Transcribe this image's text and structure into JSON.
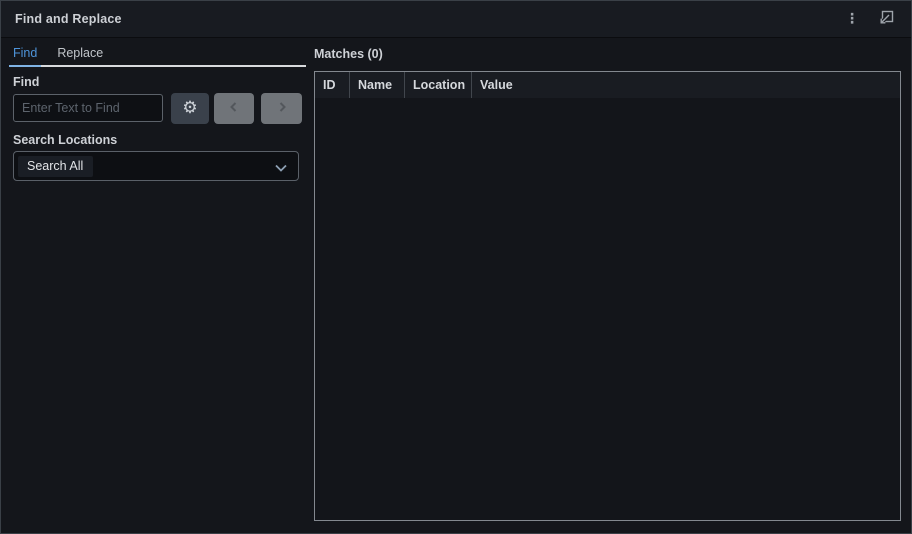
{
  "window": {
    "title": "Find and Replace"
  },
  "tabs": {
    "find": "Find",
    "replace": "Replace",
    "active_tab": "Find"
  },
  "find": {
    "label": "Find",
    "placeholder": "Enter Text to Find",
    "value": ""
  },
  "search_locations": {
    "label": "Search Locations",
    "selected": "Search All"
  },
  "matches": {
    "title": "Matches (0)",
    "count": 0,
    "columns": [
      "ID",
      "Name",
      "Location",
      "Value"
    ],
    "rows": []
  },
  "icons": {
    "more_options": "⋮",
    "gear": "⚙"
  },
  "colors": {
    "panel_background": "#14161b",
    "titlebar_background": "#181b21",
    "accent_blue": "#4e94da",
    "active_tab_underline": "#7fb3e5",
    "tab_strip_underline": "#d8dadd",
    "table_border": "#83888f",
    "disabled_button": "#707479"
  }
}
